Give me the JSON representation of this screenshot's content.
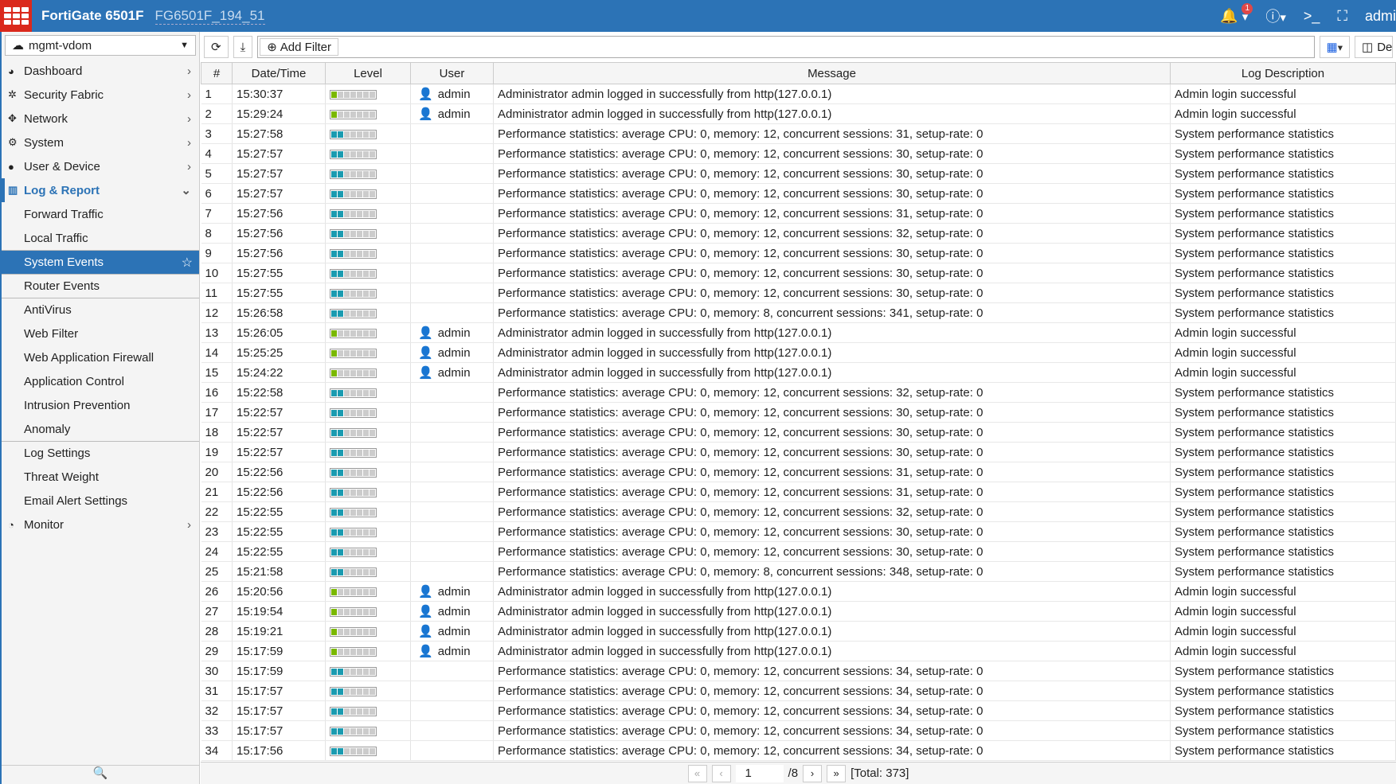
{
  "header": {
    "product": "FortiGate 6501F",
    "hostname": "FG6501F_194_51",
    "notif_count": "1",
    "user": "admi",
    "brand_color": "#2c73b6"
  },
  "sidebar": {
    "vdom": "mgmt-vdom",
    "nav": [
      {
        "label": "Dashboard",
        "icon": "dashboard-icon"
      },
      {
        "label": "Security Fabric",
        "icon": "fabric-icon"
      },
      {
        "label": "Network",
        "icon": "network-icon"
      },
      {
        "label": "System",
        "icon": "gear-icon"
      },
      {
        "label": "User & Device",
        "icon": "user-icon"
      },
      {
        "label": "Log & Report",
        "icon": "chart-icon"
      }
    ],
    "sub": [
      "Forward Traffic",
      "Local Traffic",
      "System Events",
      "Router Events",
      "AntiVirus",
      "Web Filter",
      "Web Application Firewall",
      "Application Control",
      "Intrusion Prevention",
      "Anomaly",
      "Log Settings",
      "Threat Weight",
      "Email Alert Settings"
    ],
    "monitor": "Monitor",
    "selected": "System Events"
  },
  "toolbar": {
    "add_filter": "Add Filter",
    "details": "Deta"
  },
  "table": {
    "columns": [
      "#",
      "Date/Time",
      "Level",
      "User",
      "Message",
      "Log Description"
    ],
    "level_colors": {
      "1": "#7ab800",
      "2": "#1a9bb0"
    },
    "rows": [
      [
        "1",
        "15:30:37",
        1,
        "admin",
        "Administrator admin logged in successfully from http(127.0.0.1)",
        "Admin login successful"
      ],
      [
        "2",
        "15:29:24",
        1,
        "admin",
        "Administrator admin logged in successfully from http(127.0.0.1)",
        "Admin login successful"
      ],
      [
        "3",
        "15:27:58",
        2,
        "",
        "Performance statistics: average CPU: 0, memory: 12, concurrent sessions: 31, setup-rate: 0",
        "System performance statistics"
      ],
      [
        "4",
        "15:27:57",
        2,
        "",
        "Performance statistics: average CPU: 0, memory: 12, concurrent sessions: 30, setup-rate: 0",
        "System performance statistics"
      ],
      [
        "5",
        "15:27:57",
        2,
        "",
        "Performance statistics: average CPU: 0, memory: 12, concurrent sessions: 30, setup-rate: 0",
        "System performance statistics"
      ],
      [
        "6",
        "15:27:57",
        2,
        "",
        "Performance statistics: average CPU: 0, memory: 12, concurrent sessions: 30, setup-rate: 0",
        "System performance statistics"
      ],
      [
        "7",
        "15:27:56",
        2,
        "",
        "Performance statistics: average CPU: 0, memory: 12, concurrent sessions: 31, setup-rate: 0",
        "System performance statistics"
      ],
      [
        "8",
        "15:27:56",
        2,
        "",
        "Performance statistics: average CPU: 0, memory: 12, concurrent sessions: 32, setup-rate: 0",
        "System performance statistics"
      ],
      [
        "9",
        "15:27:56",
        2,
        "",
        "Performance statistics: average CPU: 0, memory: 12, concurrent sessions: 30, setup-rate: 0",
        "System performance statistics"
      ],
      [
        "10",
        "15:27:55",
        2,
        "",
        "Performance statistics: average CPU: 0, memory: 12, concurrent sessions: 30, setup-rate: 0",
        "System performance statistics"
      ],
      [
        "11",
        "15:27:55",
        2,
        "",
        "Performance statistics: average CPU: 0, memory: 12, concurrent sessions: 30, setup-rate: 0",
        "System performance statistics"
      ],
      [
        "12",
        "15:26:58",
        2,
        "",
        "Performance statistics: average CPU: 0, memory: 8, concurrent sessions: 341, setup-rate: 0",
        "System performance statistics"
      ],
      [
        "13",
        "15:26:05",
        1,
        "admin",
        "Administrator admin logged in successfully from http(127.0.0.1)",
        "Admin login successful"
      ],
      [
        "14",
        "15:25:25",
        1,
        "admin",
        "Administrator admin logged in successfully from http(127.0.0.1)",
        "Admin login successful"
      ],
      [
        "15",
        "15:24:22",
        1,
        "admin",
        "Administrator admin logged in successfully from http(127.0.0.1)",
        "Admin login successful"
      ],
      [
        "16",
        "15:22:58",
        2,
        "",
        "Performance statistics: average CPU: 0, memory: 12, concurrent sessions: 32, setup-rate: 0",
        "System performance statistics"
      ],
      [
        "17",
        "15:22:57",
        2,
        "",
        "Performance statistics: average CPU: 0, memory: 12, concurrent sessions: 30, setup-rate: 0",
        "System performance statistics"
      ],
      [
        "18",
        "15:22:57",
        2,
        "",
        "Performance statistics: average CPU: 0, memory: 12, concurrent sessions: 30, setup-rate: 0",
        "System performance statistics"
      ],
      [
        "19",
        "15:22:57",
        2,
        "",
        "Performance statistics: average CPU: 0, memory: 12, concurrent sessions: 30, setup-rate: 0",
        "System performance statistics"
      ],
      [
        "20",
        "15:22:56",
        2,
        "",
        "Performance statistics: average CPU: 0, memory: 12, concurrent sessions: 31, setup-rate: 0",
        "System performance statistics"
      ],
      [
        "21",
        "15:22:56",
        2,
        "",
        "Performance statistics: average CPU: 0, memory: 12, concurrent sessions: 31, setup-rate: 0",
        "System performance statistics"
      ],
      [
        "22",
        "15:22:55",
        2,
        "",
        "Performance statistics: average CPU: 0, memory: 12, concurrent sessions: 32, setup-rate: 0",
        "System performance statistics"
      ],
      [
        "23",
        "15:22:55",
        2,
        "",
        "Performance statistics: average CPU: 0, memory: 12, concurrent sessions: 30, setup-rate: 0",
        "System performance statistics"
      ],
      [
        "24",
        "15:22:55",
        2,
        "",
        "Performance statistics: average CPU: 0, memory: 12, concurrent sessions: 30, setup-rate: 0",
        "System performance statistics"
      ],
      [
        "25",
        "15:21:58",
        2,
        "",
        "Performance statistics: average CPU: 0, memory: 8, concurrent sessions: 348, setup-rate: 0",
        "System performance statistics"
      ],
      [
        "26",
        "15:20:56",
        1,
        "admin",
        "Administrator admin logged in successfully from http(127.0.0.1)",
        "Admin login successful"
      ],
      [
        "27",
        "15:19:54",
        1,
        "admin",
        "Administrator admin logged in successfully from http(127.0.0.1)",
        "Admin login successful"
      ],
      [
        "28",
        "15:19:21",
        1,
        "admin",
        "Administrator admin logged in successfully from http(127.0.0.1)",
        "Admin login successful"
      ],
      [
        "29",
        "15:17:59",
        1,
        "admin",
        "Administrator admin logged in successfully from http(127.0.0.1)",
        "Admin login successful"
      ],
      [
        "30",
        "15:17:59",
        2,
        "",
        "Performance statistics: average CPU: 0, memory: 12, concurrent sessions: 34, setup-rate: 0",
        "System performance statistics"
      ],
      [
        "31",
        "15:17:57",
        2,
        "",
        "Performance statistics: average CPU: 0, memory: 12, concurrent sessions: 34, setup-rate: 0",
        "System performance statistics"
      ],
      [
        "32",
        "15:17:57",
        2,
        "",
        "Performance statistics: average CPU: 0, memory: 12, concurrent sessions: 34, setup-rate: 0",
        "System performance statistics"
      ],
      [
        "33",
        "15:17:57",
        2,
        "",
        "Performance statistics: average CPU: 0, memory: 12, concurrent sessions: 34, setup-rate: 0",
        "System performance statistics"
      ],
      [
        "34",
        "15:17:56",
        2,
        "",
        "Performance statistics: average CPU: 0, memory: 12, concurrent sessions: 34, setup-rate: 0",
        "System performance statistics"
      ]
    ]
  },
  "pager": {
    "page": "1",
    "pages": "/8",
    "total": "[Total: 373]"
  }
}
